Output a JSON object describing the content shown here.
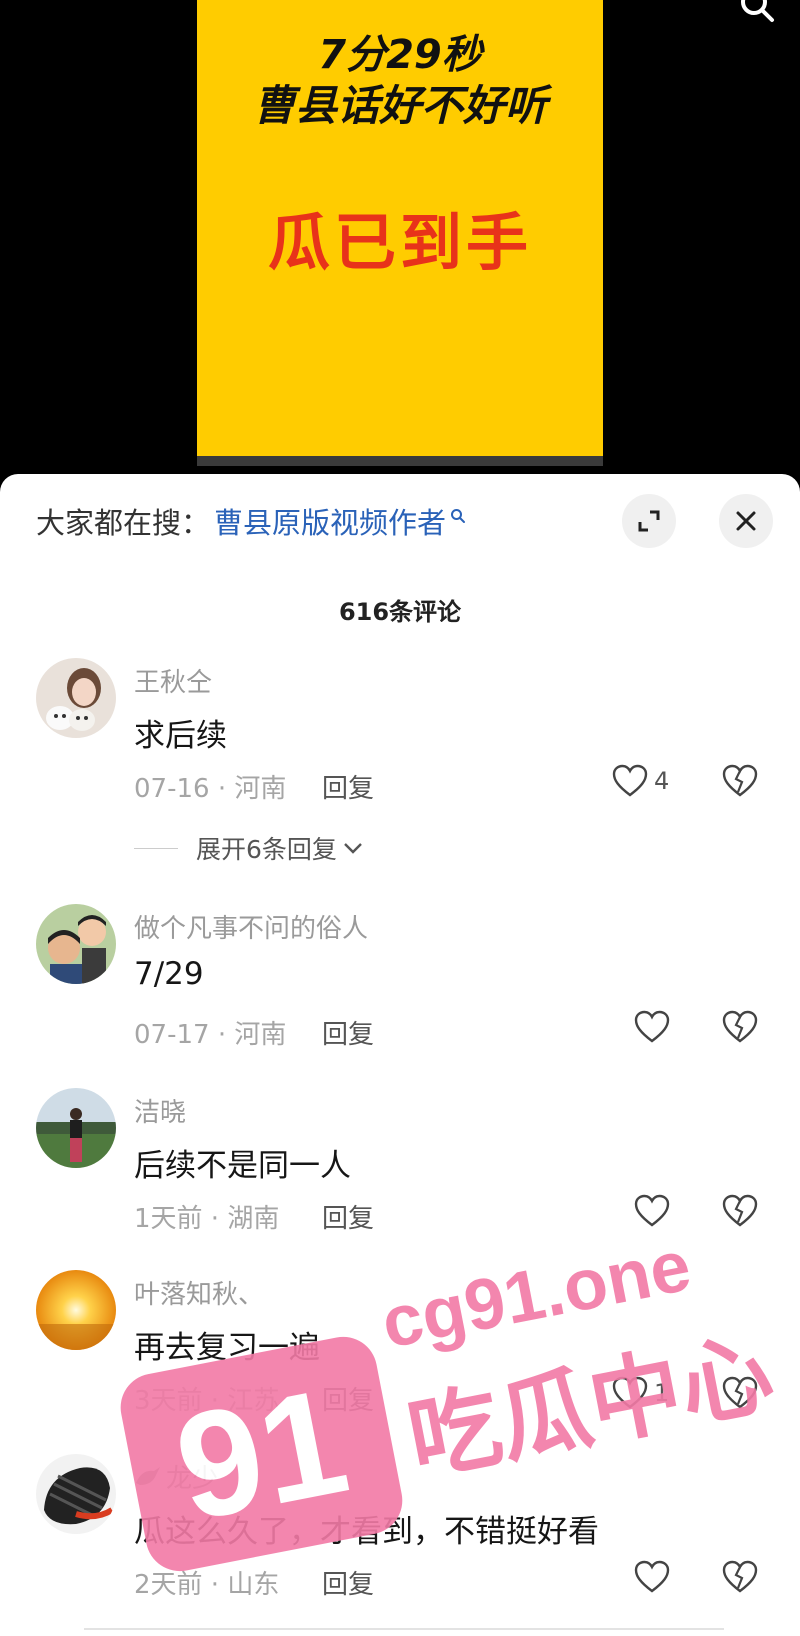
{
  "video": {
    "line1": "7分29秒",
    "line2": "曹县话好不好听",
    "line3": "瓜已到手"
  },
  "search_bar": {
    "prefix": "大家都在搜：",
    "link": "曹县原版视频作者"
  },
  "comment_count": "616条评论",
  "comments": [
    {
      "name": "王秋仝",
      "text": "求后续",
      "meta": "07-16 · 河南",
      "reply": "回复",
      "likes": "4"
    },
    {
      "name": "做个凡事不问的俗人",
      "text": "7/29",
      "meta": "07-17 · 河南",
      "reply": "回复",
      "likes": ""
    },
    {
      "name": "洁晓",
      "text": "后续不是同一人",
      "meta": "1天前 · 湖南",
      "reply": "回复",
      "likes": ""
    },
    {
      "name": "叶落知秋、",
      "text": "再去复习一遍",
      "meta": "3天前 · 江苏",
      "reply": "回复",
      "likes": "1"
    },
    {
      "name": "龙少",
      "text": "瓜这么久了，才看到，不错挺好看",
      "meta": "2天前 · 山东",
      "reply": "回复",
      "likes": ""
    }
  ],
  "expand_replies": "展开6条回复",
  "watermark": {
    "domain": "cg91.one",
    "brand_number": "91",
    "brand_name": "吃瓜中心",
    "color": "#f27aa6"
  },
  "colors": {
    "video_bg": "#ffcc00",
    "video_red_text": "#e8321a",
    "link_blue": "#2a62b8"
  }
}
